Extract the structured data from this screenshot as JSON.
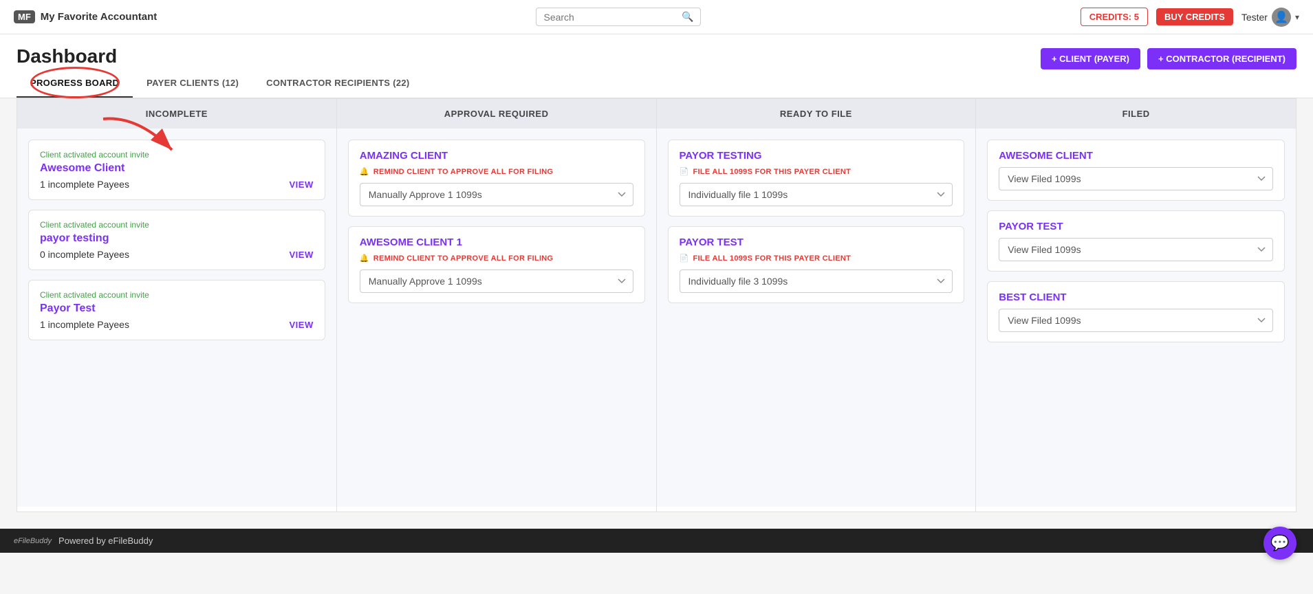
{
  "navbar": {
    "brand_initials": "MF",
    "brand_name": "My Favorite Accountant",
    "search_placeholder": "Search",
    "credits_label": "CREDITS: 5",
    "buy_credits_label": "BUY CREDITS",
    "user_name": "Tester",
    "chevron": "▾"
  },
  "page": {
    "title": "Dashboard",
    "add_client_label": "+ CLIENT (PAYER)",
    "add_contractor_label": "+ CONTRACTOR (RECIPIENT)"
  },
  "tabs": [
    {
      "id": "progress-board",
      "label": "PROGRESS BOARD",
      "active": true
    },
    {
      "id": "payer-clients",
      "label": "PAYER CLIENTS (12)",
      "active": false
    },
    {
      "id": "contractor-recipients",
      "label": "CONTRACTOR RECIPIENTS (22)",
      "active": false
    }
  ],
  "columns": [
    {
      "id": "incomplete",
      "header": "INCOMPLETE",
      "cards": [
        {
          "invite_label": "Client activated account invite",
          "client_name": "Awesome Client",
          "payees": "1 incomplete Payees",
          "view_label": "VIEW"
        },
        {
          "invite_label": "Client activated account invite",
          "client_name": "payor testing",
          "payees": "0 incomplete Payees",
          "view_label": "VIEW"
        },
        {
          "invite_label": "Client activated account invite",
          "client_name": "Payor Test",
          "payees": "1 incomplete Payees",
          "view_label": "VIEW"
        }
      ]
    },
    {
      "id": "approval-required",
      "header": "APPROVAL REQUIRED",
      "cards": [
        {
          "client_name": "AMAZING CLIENT",
          "action_label": "REMIND CLIENT TO APPROVE ALL FOR FILING",
          "dropdown_value": "Manually Approve 1 1099s"
        },
        {
          "client_name": "AWESOME CLIENT 1",
          "action_label": "REMIND CLIENT TO APPROVE ALL FOR FILING",
          "dropdown_value": "Manually Approve 1 1099s"
        }
      ]
    },
    {
      "id": "ready-to-file",
      "header": "READY TO FILE",
      "cards": [
        {
          "client_name": "PAYOR TESTING",
          "action_label": "FILE ALL 1099S FOR THIS PAYER CLIENT",
          "dropdown_value": "Individually file 1 1099s"
        },
        {
          "client_name": "PAYOR TEST",
          "action_label": "FILE ALL 1099S FOR THIS PAYER CLIENT",
          "dropdown_value": "Individually file 3 1099s"
        }
      ]
    },
    {
      "id": "filed",
      "header": "FILED",
      "cards": [
        {
          "client_name": "AWESOME CLIENT",
          "dropdown_value": "View Filed 1099s"
        },
        {
          "client_name": "PAYOR TEST",
          "dropdown_value": "View Filed 1099s"
        },
        {
          "client_name": "BEST CLIENT",
          "dropdown_value": "View Filed 1099s"
        }
      ]
    }
  ],
  "footer": {
    "powered_by": "Powered by eFileBuddy"
  },
  "icons": {
    "search": "🔍",
    "person": "👤",
    "remind": "🔔",
    "file": "📄",
    "chat": "💬"
  }
}
